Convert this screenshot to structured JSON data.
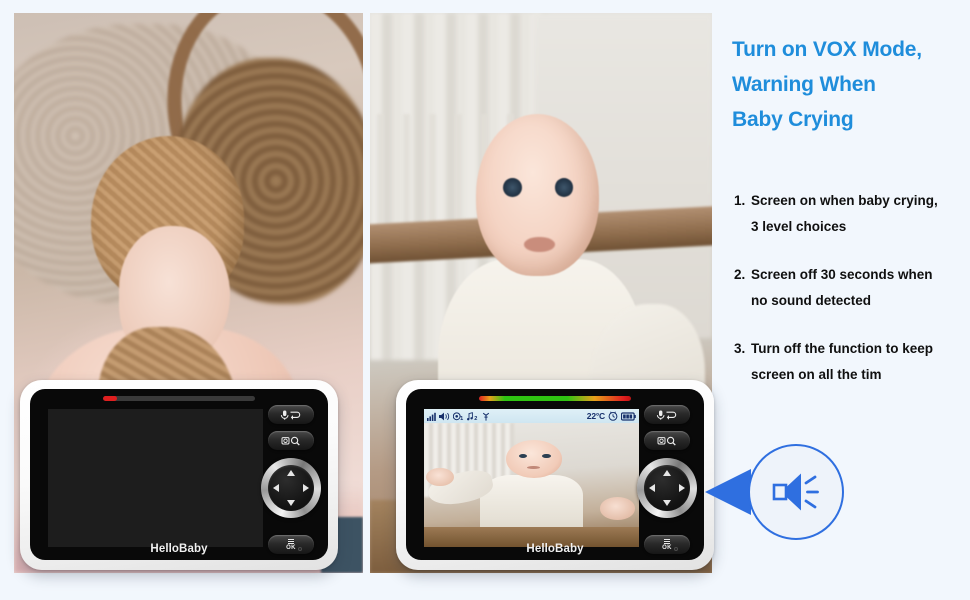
{
  "background_color": "#f2f7fd",
  "accent_color": "#1f8ddb",
  "callout_color": "#2f6fe0",
  "headline": {
    "line1": "Turn on VOX Mode,",
    "line2": "Warning When",
    "line3": "Baby Crying"
  },
  "bullets": [
    {
      "number": "1.",
      "line1": "Screen on when baby crying,",
      "line2": "3 level choices"
    },
    {
      "number": "2.",
      "line1": "Screen off 30 seconds when",
      "line2": "no sound detected"
    },
    {
      "number": "3.",
      "line1": "Turn off the function to keep",
      "line2": "screen on all the tim"
    }
  ],
  "monitor_left": {
    "brand": "HelloBaby",
    "screen_state": "off",
    "led_level": "low",
    "buttons": {
      "talk": "talk-back",
      "zoom": "camera-zoom",
      "ok": "OK"
    }
  },
  "monitor_right": {
    "brand": "HelloBaby",
    "screen_state": "on",
    "led_level": "high",
    "status_bar": {
      "signal": "signal-bars",
      "volume": "speaker",
      "camera": "1",
      "music": "2",
      "antenna": "antenna",
      "temperature": "22°C",
      "timer": "timer",
      "battery": "battery-full"
    },
    "buttons": {
      "talk": "talk-back",
      "zoom": "camera-zoom",
      "ok": "OK"
    }
  },
  "callout": {
    "icon": "speaker-sound-icon"
  }
}
